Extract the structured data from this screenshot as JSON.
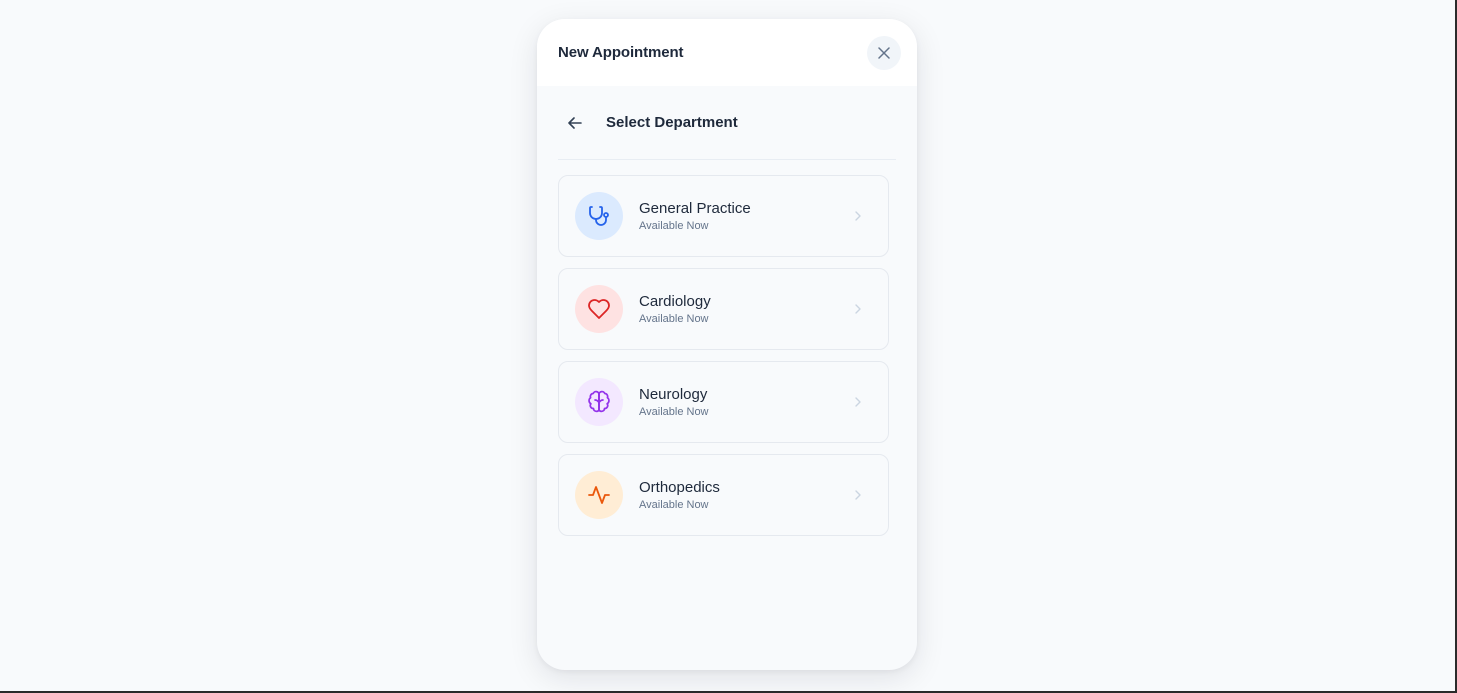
{
  "modal": {
    "title": "New Appointment"
  },
  "section": {
    "title": "Select Department"
  },
  "departments": [
    {
      "name": "General Practice",
      "status": "Available Now",
      "icon": "stethoscope-icon",
      "icon_bg": "#dbeafe",
      "icon_color": "#2563eb"
    },
    {
      "name": "Cardiology",
      "status": "Available Now",
      "icon": "heart-icon",
      "icon_bg": "#fee2e2",
      "icon_color": "#dc2626"
    },
    {
      "name": "Neurology",
      "status": "Available Now",
      "icon": "brain-icon",
      "icon_bg": "#f3e8ff",
      "icon_color": "#9333ea"
    },
    {
      "name": "Orthopedics",
      "status": "Available Now",
      "icon": "activity-icon",
      "icon_bg": "#ffedd5",
      "icon_color": "#ea580c"
    }
  ]
}
